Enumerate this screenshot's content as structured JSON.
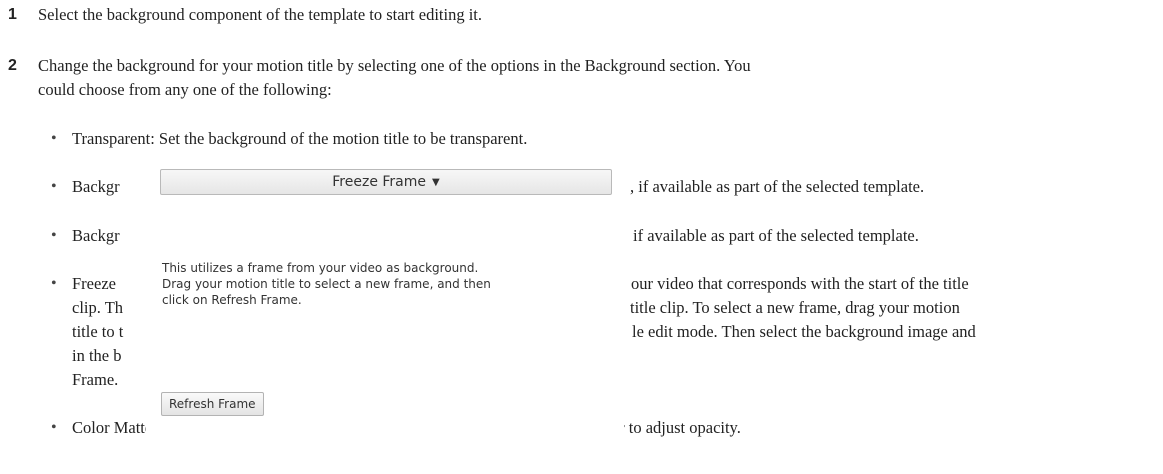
{
  "steps": [
    {
      "number": "1",
      "text": "Select the background component of the template to start editing it."
    },
    {
      "number": "2",
      "text_line1": "Change the background for your motion title by selecting one of the options in the Background section. You",
      "text_line2": "could choose from any one of the following:"
    }
  ],
  "bullets": {
    "symbol": "•",
    "transparent": "Transparent: Set the background of the motion title to be transparent.",
    "background_a_prefix": "Backgr",
    "background_a_suffix": ", if available as part of the selected template.",
    "background_b_prefix": "Backgr",
    "background_b_suffix": "if available as part of the selected template.",
    "freeze_line1_prefix": "Freeze",
    "freeze_line1_suffix": "our video that corresponds with the start of the title",
    "freeze_line2_prefix": "clip. Th",
    "freeze_line2_suffix": "title clip. To select a new frame, drag your motion",
    "freeze_line3_prefix": "title to t",
    "freeze_line3_suffix": "le edit mode. Then select the background image and",
    "freeze_line4_prefix": "in the b",
    "freeze_line5": "Frame.",
    "color_matte": "Color Matte: Use a solid color as the background for your title clip. Move the slider to adjust opacity."
  },
  "panel": {
    "dropdown_label": "Freeze Frame",
    "dropdown_arrow": "▼",
    "description_line1": "This utilizes a frame from your video as background.",
    "description_line2": "Drag your motion title to select a new frame, and then",
    "description_line3": "click on Refresh Frame.",
    "refresh_button_label": "Refresh Frame"
  }
}
